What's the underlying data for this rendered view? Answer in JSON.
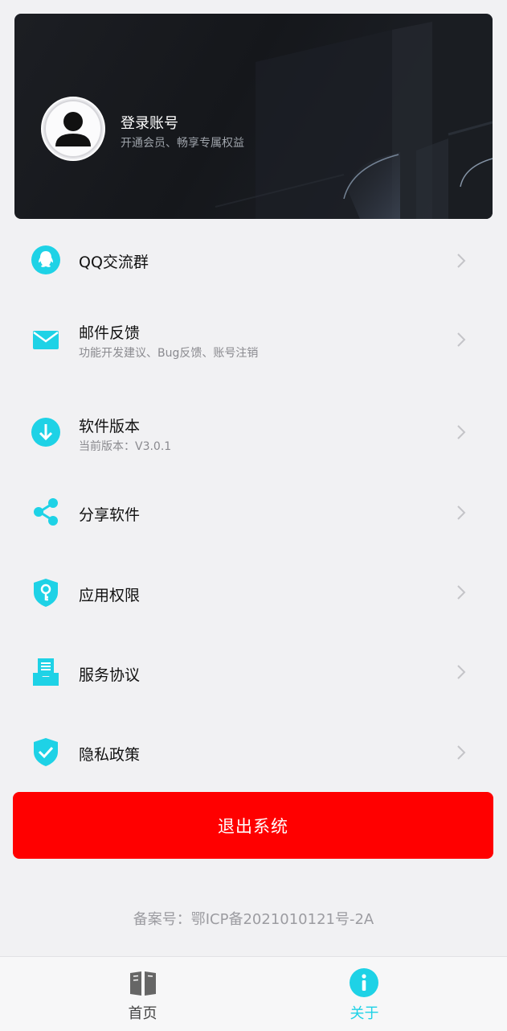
{
  "profile": {
    "title": "登录账号",
    "subtitle": "开通会员、畅享专属权益"
  },
  "menu": [
    {
      "title": "QQ交流群",
      "subtitle": "",
      "icon": "qq-penguin-icon"
    },
    {
      "title": "邮件反馈",
      "subtitle": "功能开发建议、Bug反馈、账号注销",
      "icon": "mail-icon"
    },
    {
      "title": "软件版本",
      "subtitle": "当前版本：V3.0.1",
      "icon": "download-icon"
    },
    {
      "title": "分享软件",
      "subtitle": "",
      "icon": "share-icon"
    },
    {
      "title": "应用权限",
      "subtitle": "",
      "icon": "shield-key-icon"
    },
    {
      "title": "服务协议",
      "subtitle": "",
      "icon": "document-tray-icon"
    },
    {
      "title": "隐私政策",
      "subtitle": "",
      "icon": "shield-check-icon"
    }
  ],
  "logout": {
    "label": "退出系统"
  },
  "icp": "备案号：鄂ICP备2021010121号-2A",
  "nav": {
    "tabs": [
      {
        "label": "首页",
        "icon": "book-icon",
        "active": false
      },
      {
        "label": "关于",
        "icon": "info-icon",
        "active": true
      }
    ]
  },
  "colors": {
    "accent": "#1ed2e6",
    "danger": "#ff0000",
    "header_bg": "#17191d"
  }
}
